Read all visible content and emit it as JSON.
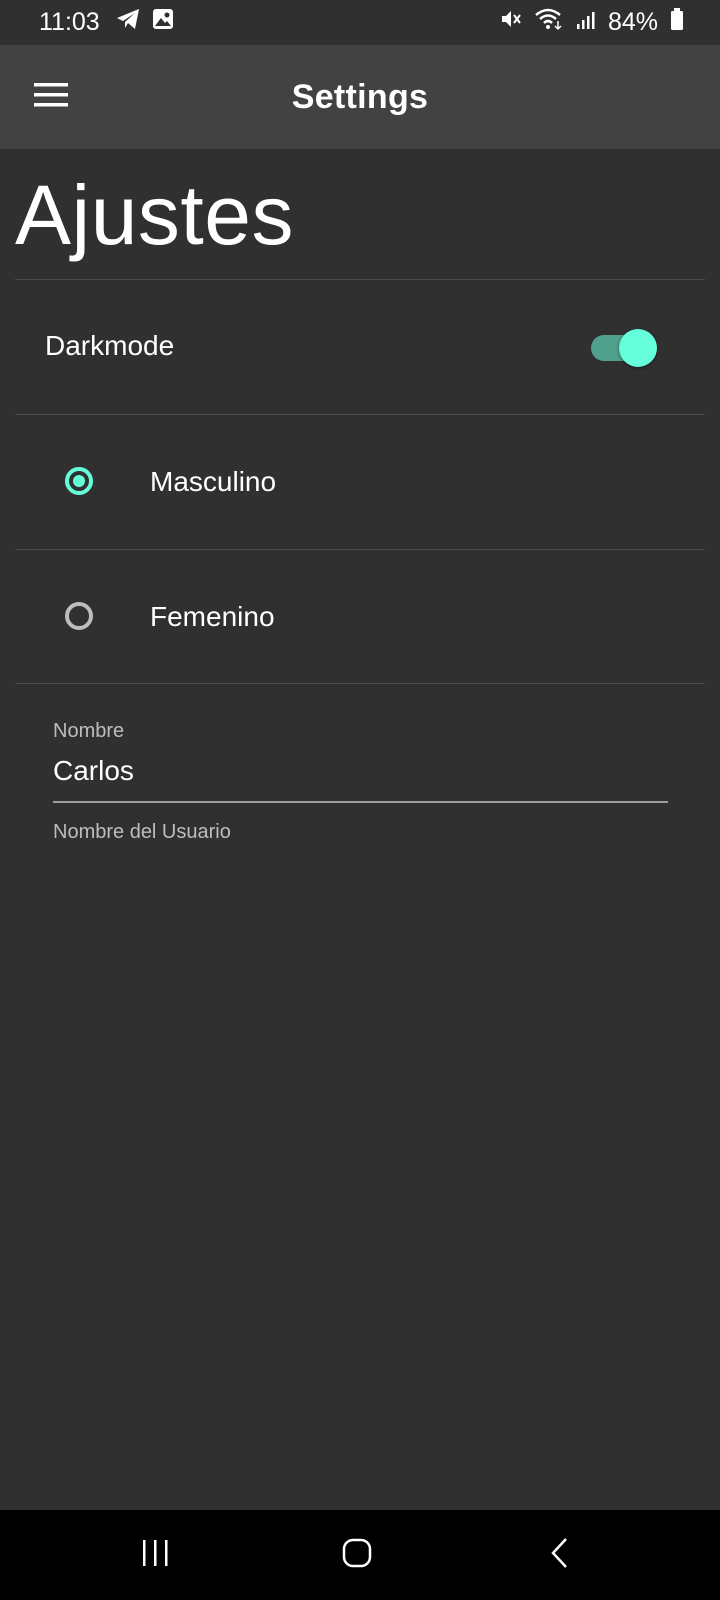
{
  "status_bar": {
    "time": "11:03",
    "left_icons": [
      "telegram-icon",
      "image-icon"
    ],
    "right_icons": [
      "mute-icon",
      "wifi-icon",
      "signal-icon",
      "battery-icon"
    ],
    "battery": "84%"
  },
  "app_bar": {
    "title": "Settings",
    "menu_icon": "hamburger-menu-icon"
  },
  "page": {
    "heading": "Ajustes"
  },
  "settings": {
    "darkmode": {
      "label": "Darkmode",
      "enabled": true
    },
    "gender_options": [
      {
        "label": "Masculino",
        "selected": true
      },
      {
        "label": "Femenino",
        "selected": false
      }
    ],
    "name_field": {
      "label": "Nombre",
      "value": "Carlos",
      "helper": "Nombre del Usuario"
    }
  },
  "nav_bar": {
    "icons": [
      "recent-apps-icon",
      "home-icon",
      "back-icon"
    ]
  },
  "colors": {
    "background": "#303030",
    "app_bar": "#424242",
    "accent": "#64ffda"
  }
}
